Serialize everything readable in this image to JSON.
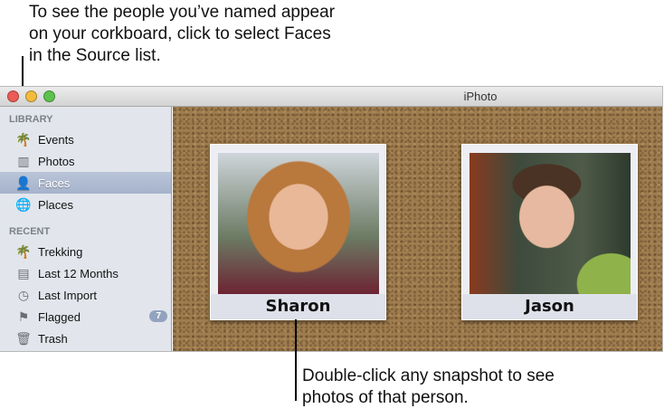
{
  "callouts": {
    "top": "To see the people you’ve named appear on your corkboard, click to select Faces in the Source list.",
    "bottom": "Double-click any snapshot to see photos of that person."
  },
  "window": {
    "title": "iPhoto"
  },
  "sidebar": {
    "library_label": "LIBRARY",
    "library": [
      {
        "label": "Events",
        "icon": "palm-icon"
      },
      {
        "label": "Photos",
        "icon": "photos-icon"
      },
      {
        "label": "Faces",
        "icon": "person-icon",
        "selected": true
      },
      {
        "label": "Places",
        "icon": "globe-icon"
      }
    ],
    "recent_label": "RECENT",
    "recent": [
      {
        "label": "Trekking",
        "icon": "palm-icon"
      },
      {
        "label": "Last 12 Months",
        "icon": "calendar-icon"
      },
      {
        "label": "Last Import",
        "icon": "clock-icon"
      },
      {
        "label": "Flagged",
        "icon": "flag-icon",
        "badge": "7"
      },
      {
        "label": "Trash",
        "icon": "trash-icon"
      }
    ]
  },
  "faces": [
    {
      "name": "Sharon"
    },
    {
      "name": "Jason"
    }
  ]
}
